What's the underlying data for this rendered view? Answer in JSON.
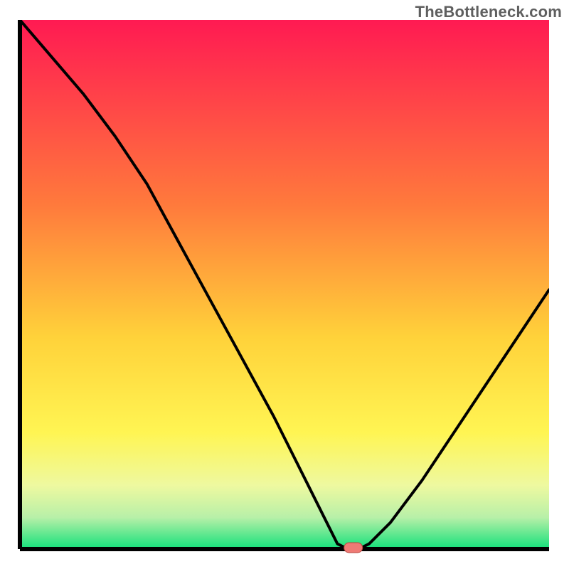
{
  "watermark": "TheBottleneck.com",
  "colors": {
    "axis": "#000000",
    "curve": "#000000",
    "marker_fill": "#ef7a75",
    "grad_top": "#ff1a52",
    "grad_mid1": "#ff7a3c",
    "grad_mid2": "#ffd23a",
    "grad_mid3": "#fff553",
    "grad_low1": "#eef9a0",
    "grad_low2": "#b8f0a8",
    "grad_bottom": "#12e07a"
  },
  "chart_data": {
    "type": "line",
    "title": "",
    "xlabel": "",
    "ylabel": "",
    "xlim": [
      0,
      100
    ],
    "ylim": [
      0,
      100
    ],
    "x": [
      0,
      6,
      12,
      18,
      24,
      30,
      36,
      42,
      48,
      54,
      58,
      60,
      62,
      64,
      66,
      70,
      76,
      82,
      88,
      94,
      100
    ],
    "y": [
      100,
      93,
      86,
      78,
      69,
      58,
      47,
      36,
      25,
      13,
      5,
      1,
      0,
      0,
      1,
      5,
      13,
      22,
      31,
      40,
      49
    ],
    "marker": {
      "x": 63,
      "y": 0
    },
    "annotations": []
  }
}
